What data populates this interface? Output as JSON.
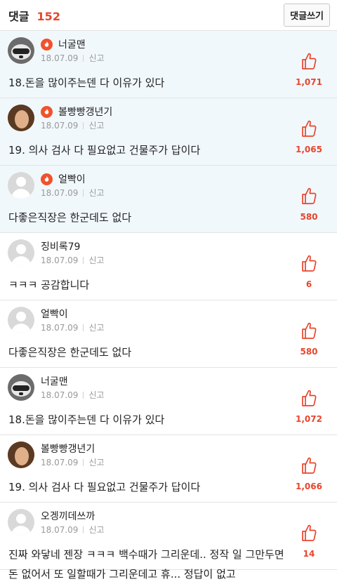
{
  "header": {
    "title": "댓글",
    "count": "152",
    "write_label": "댓글쓰기"
  },
  "colors": {
    "accent": "#e8452c",
    "best_bg": "#f1f8fc",
    "badge": "#f1522c"
  },
  "comments": [
    {
      "author": "너굴맨",
      "avatar": "raccoon-avatar",
      "best": true,
      "date": "18.07.09",
      "report": "신고",
      "text": "18.돈을 많이주는덴 다 이유가 있다",
      "likes": "1,071"
    },
    {
      "author": "볼빵빵갱년기",
      "avatar": "woman-avatar",
      "best": true,
      "date": "18.07.09",
      "report": "신고",
      "text": "19. 의사 검사 다 필요없고 건물주가 답이다",
      "likes": "1,065"
    },
    {
      "author": "얼빡이",
      "avatar": "default-avatar",
      "best": true,
      "date": "18.07.09",
      "report": "신고",
      "text": "다좋은직장은 한군데도 없다",
      "likes": "580"
    },
    {
      "author": "징비록79",
      "avatar": "default-avatar",
      "best": false,
      "date": "18.07.09",
      "report": "신고",
      "text": "ㅋㅋㅋ 공감합니다",
      "likes": "6"
    },
    {
      "author": "얼빡이",
      "avatar": "default-avatar",
      "best": false,
      "date": "18.07.09",
      "report": "신고",
      "text": "다좋은직장은 한군데도 없다",
      "likes": "580"
    },
    {
      "author": "너굴맨",
      "avatar": "raccoon-avatar",
      "best": false,
      "date": "18.07.09",
      "report": "신고",
      "text": "18.돈을 많이주는덴 다 이유가 있다",
      "likes": "1,072"
    },
    {
      "author": "볼빵빵갱년기",
      "avatar": "woman-avatar",
      "best": false,
      "date": "18.07.09",
      "report": "신고",
      "text": "19. 의사 검사 다 필요없고 건물주가 답이다",
      "likes": "1,066"
    },
    {
      "author": "오겡끼데쓰까",
      "avatar": "default-avatar",
      "best": false,
      "date": "18.07.09",
      "report": "신고",
      "text": "진짜 와닿네 젠장 ㅋㅋㅋ 백수때가 그리운데.. 정작 일 그만두면 돈 없어서 또 일할때가 그리운데고 휴... 정답이 없고",
      "likes": "14"
    }
  ]
}
